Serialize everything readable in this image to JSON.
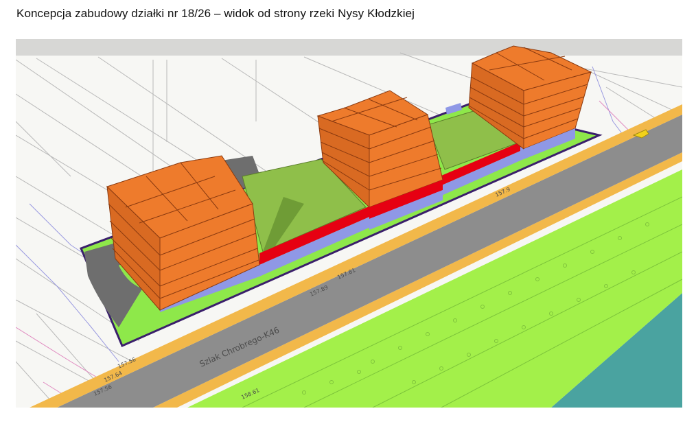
{
  "page": {
    "title": "Koncepcja zabudowy działki nr 18/26 – widok od strony rzeki Nysy Kłodzkiej"
  },
  "figure": {
    "street_label": "Szlak Chrobrego-K46",
    "elevation_labels": [
      "157.56",
      "157.64",
      "157.56",
      "157.81",
      "157.89",
      "157.9",
      "158.61"
    ],
    "colors": {
      "facade": "#ee7b2c",
      "facade_line": "#8a3a10",
      "base_level": "#8f98e6",
      "red_strip": "#e60012",
      "roof_green": "#8fbf4a",
      "lawn_green": "#8ee84a",
      "riverbank_green": "#a3f04a",
      "road": "#8d8d8d",
      "sidewalk": "#f2b84a",
      "water": "#4aa3a0",
      "plot_border": "#3a1f6b",
      "plaza": "#6e6e6e"
    }
  }
}
